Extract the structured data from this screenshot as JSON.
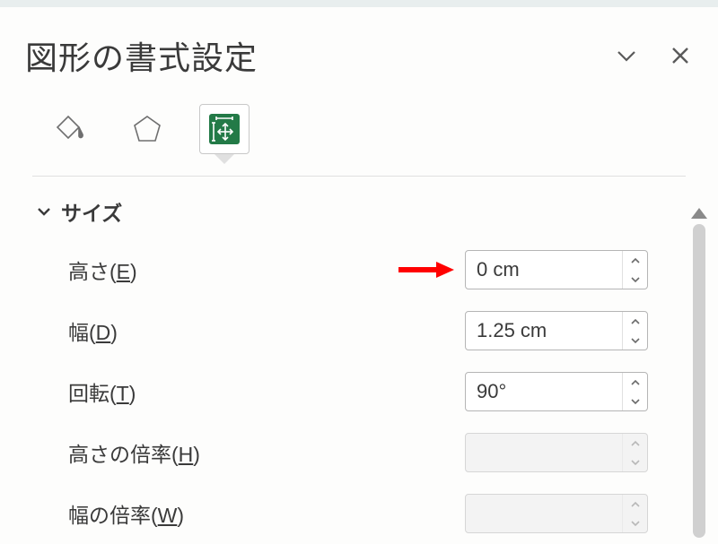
{
  "panel": {
    "title": "図形の書式設定",
    "collapse_icon": "chevron-down",
    "close_icon": "close"
  },
  "tabs": {
    "items": [
      {
        "name": "fill-line",
        "active": false
      },
      {
        "name": "effects",
        "active": false
      },
      {
        "name": "size-properties",
        "active": true
      }
    ]
  },
  "section": {
    "expanded": true,
    "title": "サイズ"
  },
  "rows": [
    {
      "label_pre": "高さ(",
      "accel": "E",
      "label_post": ")",
      "value": "0 cm",
      "disabled": false,
      "annotated": true
    },
    {
      "label_pre": "幅(",
      "accel": "D",
      "label_post": ")",
      "value": "1.25 cm",
      "disabled": false,
      "annotated": false
    },
    {
      "label_pre": "回転(",
      "accel": "T",
      "label_post": ")",
      "value": "90°",
      "disabled": false,
      "annotated": false
    },
    {
      "label_pre": "高さの倍率(",
      "accel": "H",
      "label_post": ")",
      "value": "",
      "disabled": true,
      "annotated": false
    },
    {
      "label_pre": "幅の倍率(",
      "accel": "W",
      "label_post": ")",
      "value": "",
      "disabled": true,
      "annotated": false
    }
  ],
  "annotation": {
    "color": "#ff0000"
  }
}
